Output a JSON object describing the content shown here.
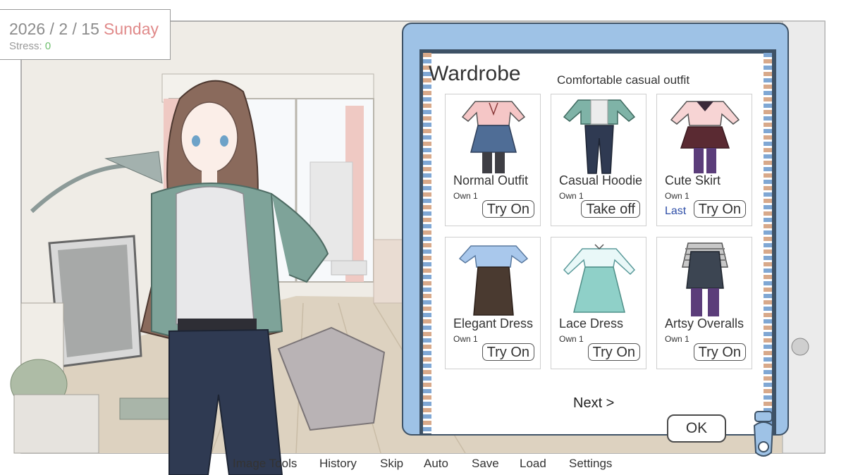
{
  "hud": {
    "date": "2026 / 2 / 15",
    "day": "Sunday",
    "stress_label": "Stress: ",
    "stress_value": "0"
  },
  "wardrobe": {
    "title": "Wardrobe",
    "description": "Comfortable casual outfit",
    "items": [
      {
        "name": "Normal Outfit",
        "owned": "Own 1",
        "action": "Try On",
        "last": ""
      },
      {
        "name": "Casual Hoodie",
        "owned": "Own 1",
        "action": "Take off",
        "last": ""
      },
      {
        "name": "Cute Skirt",
        "owned": "Own 1",
        "action": "Try On",
        "last": "Last"
      },
      {
        "name": "Elegant Dress",
        "owned": "Own 1",
        "action": "Try On",
        "last": ""
      },
      {
        "name": "Lace Dress",
        "owned": "Own 1",
        "action": "Try On",
        "last": ""
      },
      {
        "name": "Artsy Overalls",
        "owned": "Own 1",
        "action": "Try On",
        "last": ""
      }
    ],
    "next_label": "Next >",
    "ok_label": "OK"
  },
  "quick_menu": [
    "Image Tools",
    "History",
    "Skip",
    "Auto",
    "Save",
    "Load",
    "Settings"
  ],
  "colors": {
    "frame": "#9ec2e6",
    "accent_day": "#e08a8a",
    "stress_ok": "#6fbf6f",
    "last_label": "#2f4fa8"
  }
}
